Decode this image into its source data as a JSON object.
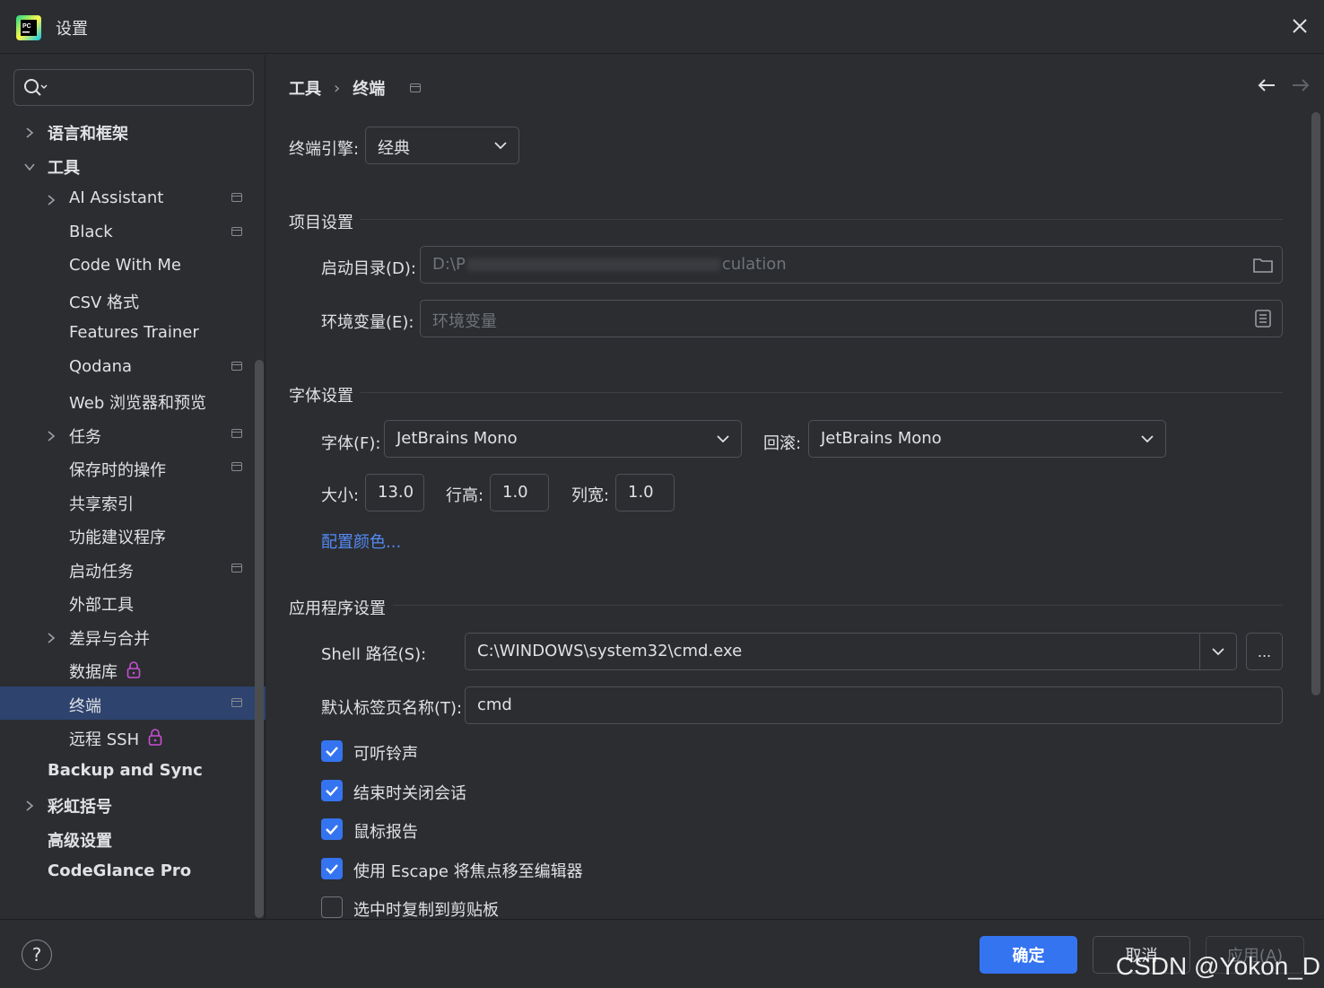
{
  "window": {
    "title": "设置"
  },
  "sidebar": {
    "search_placeholder": "",
    "items": [
      {
        "label": "语言和框架",
        "level": 0,
        "expandable": true,
        "expanded": false,
        "bold": true,
        "badge": false
      },
      {
        "label": "工具",
        "level": 0,
        "expandable": true,
        "expanded": true,
        "bold": true,
        "badge": false
      },
      {
        "label": "AI Assistant",
        "level": 1,
        "expandable": true,
        "expanded": false,
        "badge": true
      },
      {
        "label": "Black",
        "level": 1,
        "badge": true
      },
      {
        "label": "Code With Me",
        "level": 1,
        "badge": false
      },
      {
        "label": "CSV 格式",
        "level": 1,
        "badge": false
      },
      {
        "label": "Features Trainer",
        "level": 1,
        "badge": false
      },
      {
        "label": "Qodana",
        "level": 1,
        "badge": true
      },
      {
        "label": "Web 浏览器和预览",
        "level": 1,
        "badge": false
      },
      {
        "label": "任务",
        "level": 1,
        "expandable": true,
        "expanded": false,
        "badge": true
      },
      {
        "label": "保存时的操作",
        "level": 1,
        "badge": true
      },
      {
        "label": "共享索引",
        "level": 1,
        "badge": false
      },
      {
        "label": "功能建议程序",
        "level": 1,
        "badge": false
      },
      {
        "label": "启动任务",
        "level": 1,
        "badge": true
      },
      {
        "label": "外部工具",
        "level": 1,
        "badge": false
      },
      {
        "label": "差异与合并",
        "level": 1,
        "expandable": true,
        "expanded": false,
        "badge": false
      },
      {
        "label": "数据库",
        "level": 1,
        "badge": false,
        "lock": true
      },
      {
        "label": "终端",
        "level": 1,
        "badge": true,
        "selected": true
      },
      {
        "label": "远程 SSH",
        "level": 1,
        "badge": false,
        "lock": true
      },
      {
        "label": "Backup and Sync",
        "level": 0,
        "bold": true,
        "badge": false
      },
      {
        "label": "彩虹括号",
        "level": 0,
        "expandable": true,
        "expanded": false,
        "bold": true,
        "badge": false
      },
      {
        "label": "高级设置",
        "level": 0,
        "bold": true,
        "badge": false
      },
      {
        "label": "CodeGlance Pro",
        "level": 0,
        "bold": true,
        "badge": false
      }
    ]
  },
  "breadcrumb": {
    "parent": "工具",
    "separator": "›",
    "current": "终端"
  },
  "engine": {
    "label": "终端引擎:",
    "value": "经典"
  },
  "project": {
    "section": "项目设置",
    "start_dir_label": "启动目录(D):",
    "start_dir_value": "D:\\P",
    "start_dir_value_end": "culation",
    "env_label": "环境变量(E):",
    "env_placeholder": "环境变量"
  },
  "font": {
    "section": "字体设置",
    "font_label": "字体(F):",
    "font_value": "JetBrains Mono",
    "fallback_label": "回滚:",
    "fallback_value": "JetBrains Mono",
    "size_label": "大小:",
    "size_value": "13.0",
    "line_height_label": "行高:",
    "line_height_value": "1.0",
    "col_width_label": "列宽:",
    "col_width_value": "1.0",
    "color_link": "配置颜色..."
  },
  "app": {
    "section": "应用程序设置",
    "shell_label": "Shell 路径(S):",
    "shell_value": "C:\\WINDOWS\\system32\\cmd.exe",
    "browse_label": "...",
    "tab_name_label": "默认标签页名称(T):",
    "tab_name_value": "cmd",
    "checkboxes": [
      {
        "label": "可听铃声",
        "checked": true
      },
      {
        "label": "结束时关闭会话",
        "checked": true
      },
      {
        "label": "鼠标报告",
        "checked": true
      },
      {
        "label": "使用 Escape 将焦点移至编辑器",
        "checked": true
      },
      {
        "label": "选中时复制到剪贴板",
        "checked": false
      }
    ]
  },
  "footer": {
    "help": "?",
    "ok": "确定",
    "cancel": "取消",
    "apply": "应用(A)"
  },
  "watermark": "CSDN @Yokon_D",
  "colors": {
    "accent": "#3574f0",
    "selected_bg": "#2e436e",
    "link": "#548af7",
    "bg": "#2b2d30"
  }
}
